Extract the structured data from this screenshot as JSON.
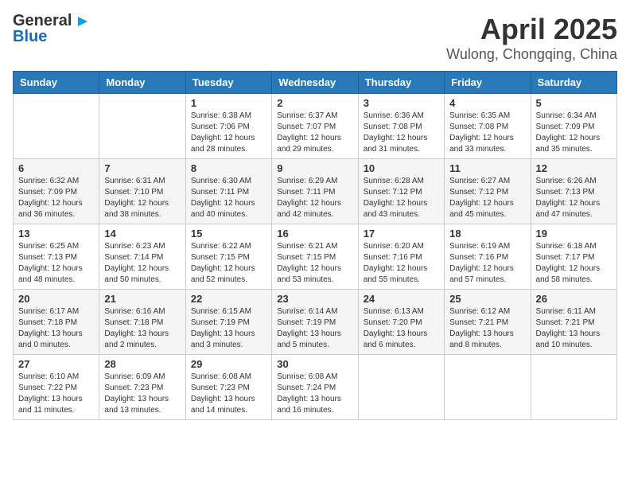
{
  "header": {
    "logo_general": "General",
    "logo_blue": "Blue",
    "title": "April 2025",
    "subtitle": "Wulong, Chongqing, China"
  },
  "days_of_week": [
    "Sunday",
    "Monday",
    "Tuesday",
    "Wednesday",
    "Thursday",
    "Friday",
    "Saturday"
  ],
  "weeks": [
    [
      {
        "day": "",
        "sunrise": "",
        "sunset": "",
        "daylight": ""
      },
      {
        "day": "",
        "sunrise": "",
        "sunset": "",
        "daylight": ""
      },
      {
        "day": "1",
        "sunrise": "Sunrise: 6:38 AM",
        "sunset": "Sunset: 7:06 PM",
        "daylight": "Daylight: 12 hours and 28 minutes."
      },
      {
        "day": "2",
        "sunrise": "Sunrise: 6:37 AM",
        "sunset": "Sunset: 7:07 PM",
        "daylight": "Daylight: 12 hours and 29 minutes."
      },
      {
        "day": "3",
        "sunrise": "Sunrise: 6:36 AM",
        "sunset": "Sunset: 7:08 PM",
        "daylight": "Daylight: 12 hours and 31 minutes."
      },
      {
        "day": "4",
        "sunrise": "Sunrise: 6:35 AM",
        "sunset": "Sunset: 7:08 PM",
        "daylight": "Daylight: 12 hours and 33 minutes."
      },
      {
        "day": "5",
        "sunrise": "Sunrise: 6:34 AM",
        "sunset": "Sunset: 7:09 PM",
        "daylight": "Daylight: 12 hours and 35 minutes."
      }
    ],
    [
      {
        "day": "6",
        "sunrise": "Sunrise: 6:32 AM",
        "sunset": "Sunset: 7:09 PM",
        "daylight": "Daylight: 12 hours and 36 minutes."
      },
      {
        "day": "7",
        "sunrise": "Sunrise: 6:31 AM",
        "sunset": "Sunset: 7:10 PM",
        "daylight": "Daylight: 12 hours and 38 minutes."
      },
      {
        "day": "8",
        "sunrise": "Sunrise: 6:30 AM",
        "sunset": "Sunset: 7:11 PM",
        "daylight": "Daylight: 12 hours and 40 minutes."
      },
      {
        "day": "9",
        "sunrise": "Sunrise: 6:29 AM",
        "sunset": "Sunset: 7:11 PM",
        "daylight": "Daylight: 12 hours and 42 minutes."
      },
      {
        "day": "10",
        "sunrise": "Sunrise: 6:28 AM",
        "sunset": "Sunset: 7:12 PM",
        "daylight": "Daylight: 12 hours and 43 minutes."
      },
      {
        "day": "11",
        "sunrise": "Sunrise: 6:27 AM",
        "sunset": "Sunset: 7:12 PM",
        "daylight": "Daylight: 12 hours and 45 minutes."
      },
      {
        "day": "12",
        "sunrise": "Sunrise: 6:26 AM",
        "sunset": "Sunset: 7:13 PM",
        "daylight": "Daylight: 12 hours and 47 minutes."
      }
    ],
    [
      {
        "day": "13",
        "sunrise": "Sunrise: 6:25 AM",
        "sunset": "Sunset: 7:13 PM",
        "daylight": "Daylight: 12 hours and 48 minutes."
      },
      {
        "day": "14",
        "sunrise": "Sunrise: 6:23 AM",
        "sunset": "Sunset: 7:14 PM",
        "daylight": "Daylight: 12 hours and 50 minutes."
      },
      {
        "day": "15",
        "sunrise": "Sunrise: 6:22 AM",
        "sunset": "Sunset: 7:15 PM",
        "daylight": "Daylight: 12 hours and 52 minutes."
      },
      {
        "day": "16",
        "sunrise": "Sunrise: 6:21 AM",
        "sunset": "Sunset: 7:15 PM",
        "daylight": "Daylight: 12 hours and 53 minutes."
      },
      {
        "day": "17",
        "sunrise": "Sunrise: 6:20 AM",
        "sunset": "Sunset: 7:16 PM",
        "daylight": "Daylight: 12 hours and 55 minutes."
      },
      {
        "day": "18",
        "sunrise": "Sunrise: 6:19 AM",
        "sunset": "Sunset: 7:16 PM",
        "daylight": "Daylight: 12 hours and 57 minutes."
      },
      {
        "day": "19",
        "sunrise": "Sunrise: 6:18 AM",
        "sunset": "Sunset: 7:17 PM",
        "daylight": "Daylight: 12 hours and 58 minutes."
      }
    ],
    [
      {
        "day": "20",
        "sunrise": "Sunrise: 6:17 AM",
        "sunset": "Sunset: 7:18 PM",
        "daylight": "Daylight: 13 hours and 0 minutes."
      },
      {
        "day": "21",
        "sunrise": "Sunrise: 6:16 AM",
        "sunset": "Sunset: 7:18 PM",
        "daylight": "Daylight: 13 hours and 2 minutes."
      },
      {
        "day": "22",
        "sunrise": "Sunrise: 6:15 AM",
        "sunset": "Sunset: 7:19 PM",
        "daylight": "Daylight: 13 hours and 3 minutes."
      },
      {
        "day": "23",
        "sunrise": "Sunrise: 6:14 AM",
        "sunset": "Sunset: 7:19 PM",
        "daylight": "Daylight: 13 hours and 5 minutes."
      },
      {
        "day": "24",
        "sunrise": "Sunrise: 6:13 AM",
        "sunset": "Sunset: 7:20 PM",
        "daylight": "Daylight: 13 hours and 6 minutes."
      },
      {
        "day": "25",
        "sunrise": "Sunrise: 6:12 AM",
        "sunset": "Sunset: 7:21 PM",
        "daylight": "Daylight: 13 hours and 8 minutes."
      },
      {
        "day": "26",
        "sunrise": "Sunrise: 6:11 AM",
        "sunset": "Sunset: 7:21 PM",
        "daylight": "Daylight: 13 hours and 10 minutes."
      }
    ],
    [
      {
        "day": "27",
        "sunrise": "Sunrise: 6:10 AM",
        "sunset": "Sunset: 7:22 PM",
        "daylight": "Daylight: 13 hours and 11 minutes."
      },
      {
        "day": "28",
        "sunrise": "Sunrise: 6:09 AM",
        "sunset": "Sunset: 7:23 PM",
        "daylight": "Daylight: 13 hours and 13 minutes."
      },
      {
        "day": "29",
        "sunrise": "Sunrise: 6:08 AM",
        "sunset": "Sunset: 7:23 PM",
        "daylight": "Daylight: 13 hours and 14 minutes."
      },
      {
        "day": "30",
        "sunrise": "Sunrise: 6:08 AM",
        "sunset": "Sunset: 7:24 PM",
        "daylight": "Daylight: 13 hours and 16 minutes."
      },
      {
        "day": "",
        "sunrise": "",
        "sunset": "",
        "daylight": ""
      },
      {
        "day": "",
        "sunrise": "",
        "sunset": "",
        "daylight": ""
      },
      {
        "day": "",
        "sunrise": "",
        "sunset": "",
        "daylight": ""
      }
    ]
  ]
}
